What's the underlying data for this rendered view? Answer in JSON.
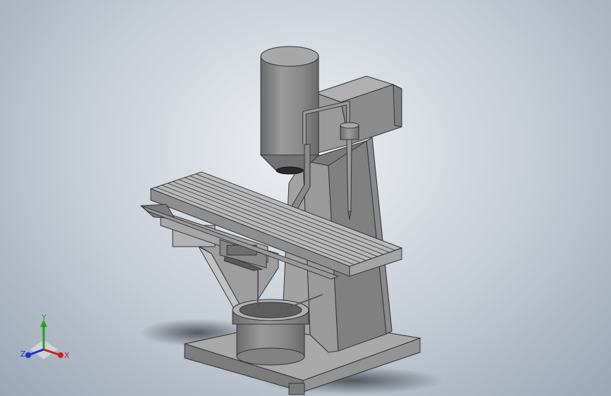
{
  "triad": {
    "x_label": "X",
    "y_label": "Y",
    "z_label": "Z",
    "x_color": "#c62020",
    "y_color": "#20a020",
    "z_color": "#2030c8"
  },
  "model": {
    "shade_light": "#a8a8a8",
    "shade_mid": "#8e8e8e",
    "shade_dark": "#6e6e6e",
    "shade_top": "#b4b4b4"
  }
}
